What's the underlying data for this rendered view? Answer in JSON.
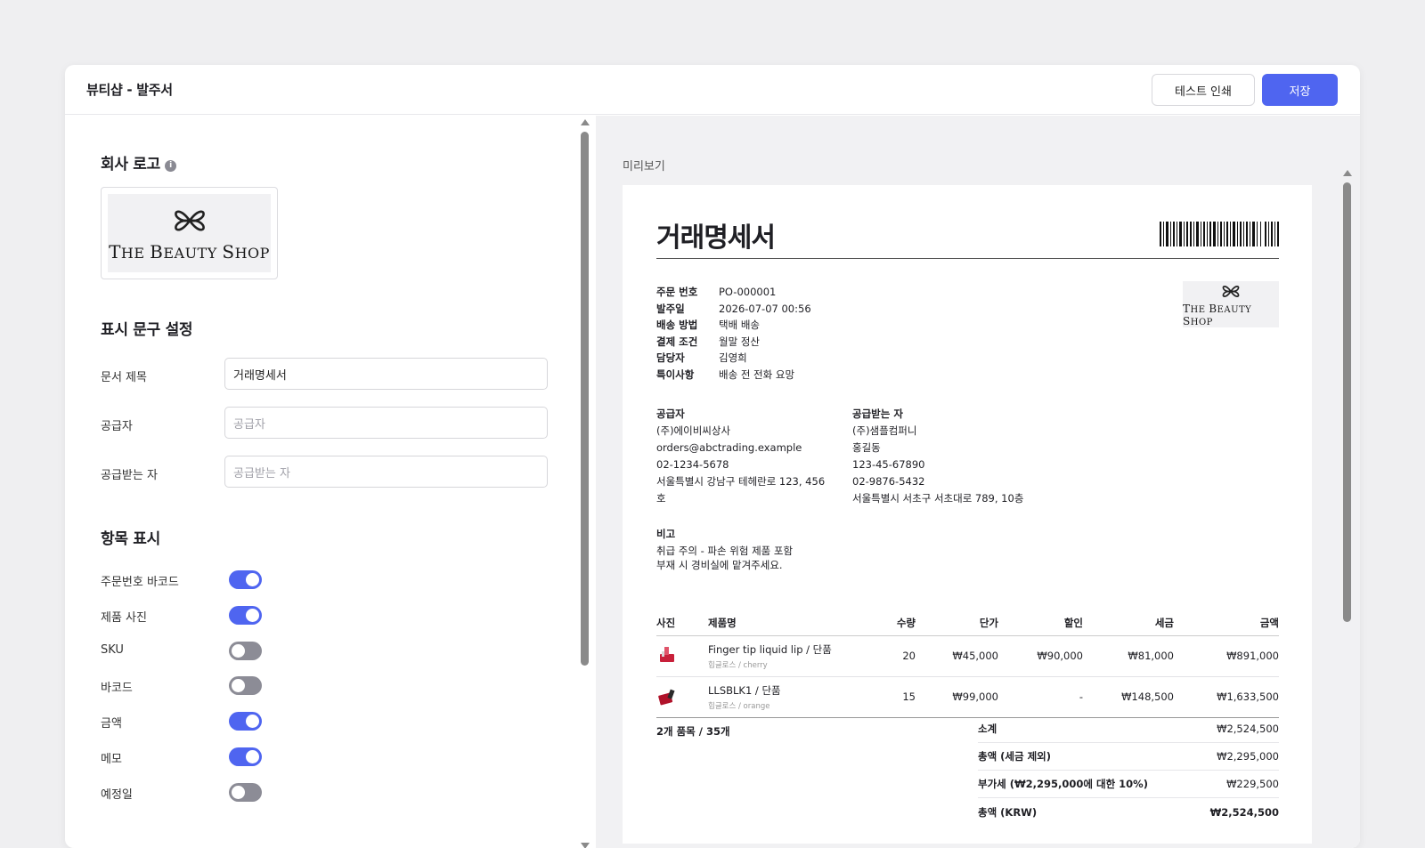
{
  "window": {
    "title": "뷰티샵 - 발주서"
  },
  "toolbar": {
    "print_label": "테스트 인쇄",
    "save_label": "저장",
    "accent": "#4f65f0"
  },
  "settings": {
    "logo_section": {
      "title": "회사 로고",
      "info_icon": "info-icon"
    },
    "logo": {
      "icon": "flower-icon",
      "text": "THE BEAUTY SHOP"
    },
    "text_section": {
      "title": "표시 문구 설정",
      "fields": [
        {
          "label": "문서 제목",
          "value": "거래명세서",
          "placeholder": ""
        },
        {
          "label": "공급자",
          "value": "",
          "placeholder": "공급자"
        },
        {
          "label": "공급받는 자",
          "value": "",
          "placeholder": "공급받는 자"
        }
      ]
    },
    "display_section": {
      "title": "항목 표시",
      "toggles": [
        {
          "label": "주문번호 바코드",
          "on": true
        },
        {
          "label": "제품 사진",
          "on": true
        },
        {
          "label": "SKU",
          "on": false
        },
        {
          "label": "바코드",
          "on": false
        },
        {
          "label": "금액",
          "on": true
        },
        {
          "label": "메모",
          "on": true
        },
        {
          "label": "예정일",
          "on": false
        }
      ]
    }
  },
  "preview": {
    "label": "미리보기",
    "doc_title": "거래명세서",
    "meta": [
      {
        "k": "주문 번호",
        "v": "PO-000001"
      },
      {
        "k": "발주일",
        "v": "2026-07-07 00:56"
      },
      {
        "k": "배송 방법",
        "v": "택배 배송"
      },
      {
        "k": "결제 조건",
        "v": "월말 정산"
      },
      {
        "k": "담당자",
        "v": "김영희"
      },
      {
        "k": "특이사항",
        "v": "배송 전 전화 요망"
      }
    ],
    "supplier": {
      "heading": "공급자",
      "lines": [
        "(주)에이비씨상사",
        "orders@abctrading.example",
        "02-1234-5678",
        "서울특별시 강남구 테헤란로 123, 456",
        "호"
      ]
    },
    "receiver": {
      "heading": "공급받는 자",
      "lines": [
        "(주)샘플컴퍼니",
        "홍길동",
        "123-45-67890",
        "02-9876-5432",
        "서울특별시 서초구 서초대로 789, 10층"
      ]
    },
    "remarks": {
      "heading": "비고",
      "lines": [
        "취급 주의 - 파손 위험 제품 포함",
        "부재 시 경비실에 맡겨주세요."
      ]
    },
    "table": {
      "headers": [
        "사진",
        "제품명",
        "수량",
        "단가",
        "할인",
        "세금",
        "금액"
      ],
      "rows": [
        {
          "icon": "lipstick-icon",
          "name": "Finger tip liquid lip / 단품",
          "sub": "힙글로스 / cherry",
          "qty": "20",
          "price": "₩45,000",
          "discount": "₩90,000",
          "tax": "₩81,000",
          "amount": "₩891,000"
        },
        {
          "icon": "lipstick-icon",
          "name": "LLSBLK1 / 단품",
          "sub": "힙글로스 / orange",
          "qty": "15",
          "price": "₩99,000",
          "discount": "-",
          "tax": "₩148,500",
          "amount": "₩1,633,500"
        }
      ]
    },
    "summary": {
      "count": "2개 품목 / 35개",
      "rows": [
        {
          "k": "소계",
          "v": "₩2,524,500"
        },
        {
          "k": "총액 (세금 제외)",
          "v": "₩2,295,000"
        },
        {
          "k": "부가세 (₩2,295,000에 대한 10%)",
          "v": "₩229,500"
        },
        {
          "k": "총액 (KRW)",
          "v": "₩2,524,500"
        }
      ]
    }
  }
}
